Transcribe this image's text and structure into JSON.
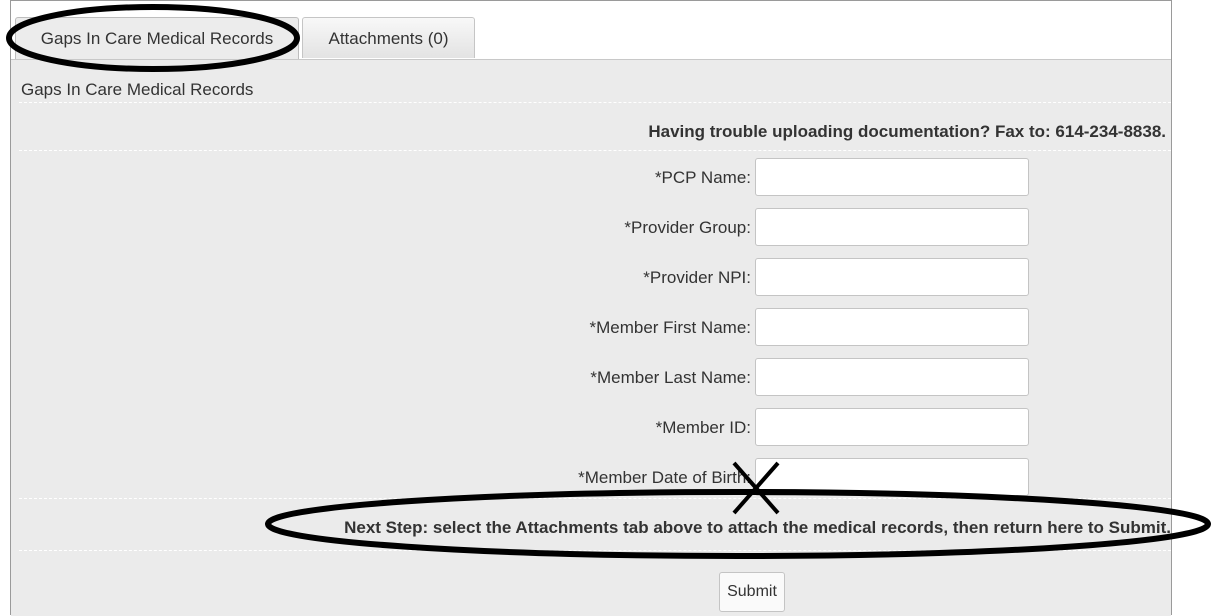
{
  "tabs": [
    {
      "label": "Gaps In Care Medical Records"
    },
    {
      "label": "Attachments (0)"
    }
  ],
  "panel": {
    "title": "Gaps In Care Medical Records"
  },
  "notice": "Having trouble uploading documentation? Fax to: 614-234-8838.",
  "fields": [
    {
      "label": "*PCP Name:",
      "value": ""
    },
    {
      "label": "*Provider Group:",
      "value": ""
    },
    {
      "label": "*Provider NPI:",
      "value": ""
    },
    {
      "label": "*Member First Name:",
      "value": ""
    },
    {
      "label": "*Member Last Name:",
      "value": ""
    },
    {
      "label": "*Member ID:",
      "value": ""
    },
    {
      "label": "*Member Date of Birth:",
      "value": ""
    }
  ],
  "next_step": "Next Step: select the Attachments tab above to attach the medical records, then return here to Submit.",
  "submit_label": "Submit"
}
